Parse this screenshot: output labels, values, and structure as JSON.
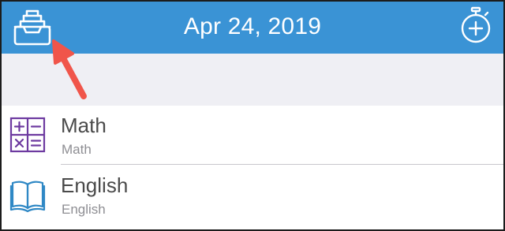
{
  "navbar": {
    "title": "Apr 24, 2019",
    "left_icon": "inbox-tray-icon",
    "right_icon": "stopwatch-plus-icon",
    "background_color": "#3a93d5"
  },
  "subjects": [
    {
      "title": "Math",
      "subtitle": "Math",
      "icon": "calculator-grid-icon",
      "icon_color": "#6d3aa0"
    },
    {
      "title": "English",
      "subtitle": "English",
      "icon": "open-book-icon",
      "icon_color": "#2f88c5"
    }
  ],
  "annotation": {
    "icon": "red-arrow-icon",
    "color": "#f0554a"
  }
}
